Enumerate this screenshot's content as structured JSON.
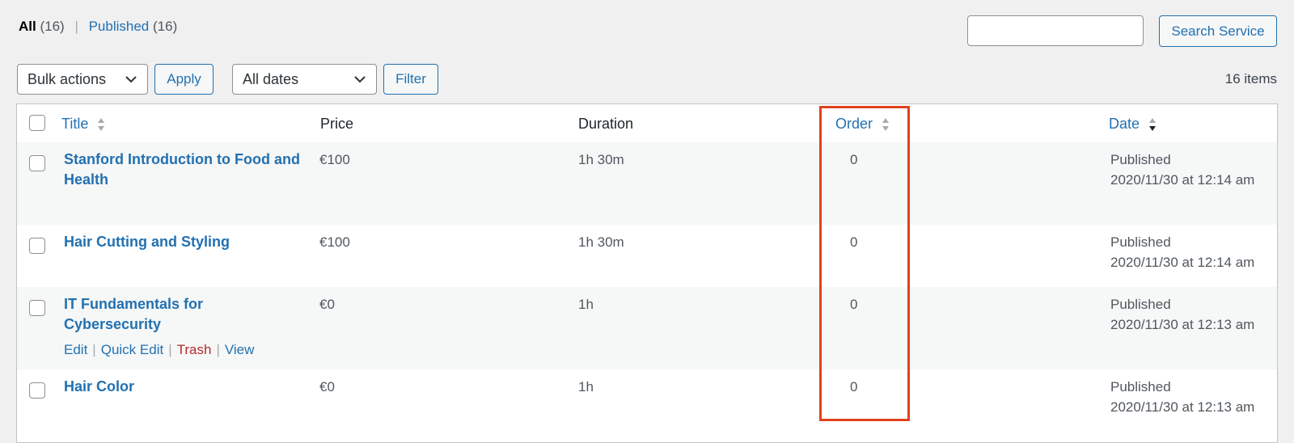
{
  "views": {
    "all_label": "All",
    "all_count": "(16)",
    "separator": "|",
    "published_label": "Published",
    "published_count": "(16)"
  },
  "search": {
    "value": "",
    "button_label": "Search Service"
  },
  "bulk": {
    "select_value": "Bulk actions",
    "apply_label": "Apply",
    "dates_value": "All dates",
    "filter_label": "Filter",
    "items_count": "16 items"
  },
  "columns": {
    "title": "Title",
    "price": "Price",
    "duration": "Duration",
    "order": "Order",
    "date": "Date"
  },
  "rows": [
    {
      "title": "Stanford Introduction to Food and Health",
      "price": "€100",
      "duration": "1h 30m",
      "order": "0",
      "status": "Published",
      "date": "2020/11/30 at 12:14 am"
    },
    {
      "title": "Hair Cutting and Styling",
      "price": "€100",
      "duration": "1h 30m",
      "order": "0",
      "status": "Published",
      "date": "2020/11/30 at 12:14 am"
    },
    {
      "title": "IT Fundamentals for Cybersecurity",
      "price": "€0",
      "duration": "1h",
      "order": "0",
      "status": "Published",
      "date": "2020/11/30 at 12:13 am",
      "row_actions": {
        "edit": "Edit",
        "quick_edit": "Quick Edit",
        "trash": "Trash",
        "view": "View",
        "separator": "|"
      }
    },
    {
      "title": "Hair Color",
      "price": "€0",
      "duration": "1h",
      "order": "0",
      "status": "Published",
      "date": "2020/11/30 at 12:13 am"
    }
  ],
  "colors": {
    "link": "#2271b1",
    "trash": "#b32d2e",
    "highlight": "#e2411f",
    "background": "#f0f0f1"
  },
  "annotation": {
    "highlighted_column": "Order"
  }
}
